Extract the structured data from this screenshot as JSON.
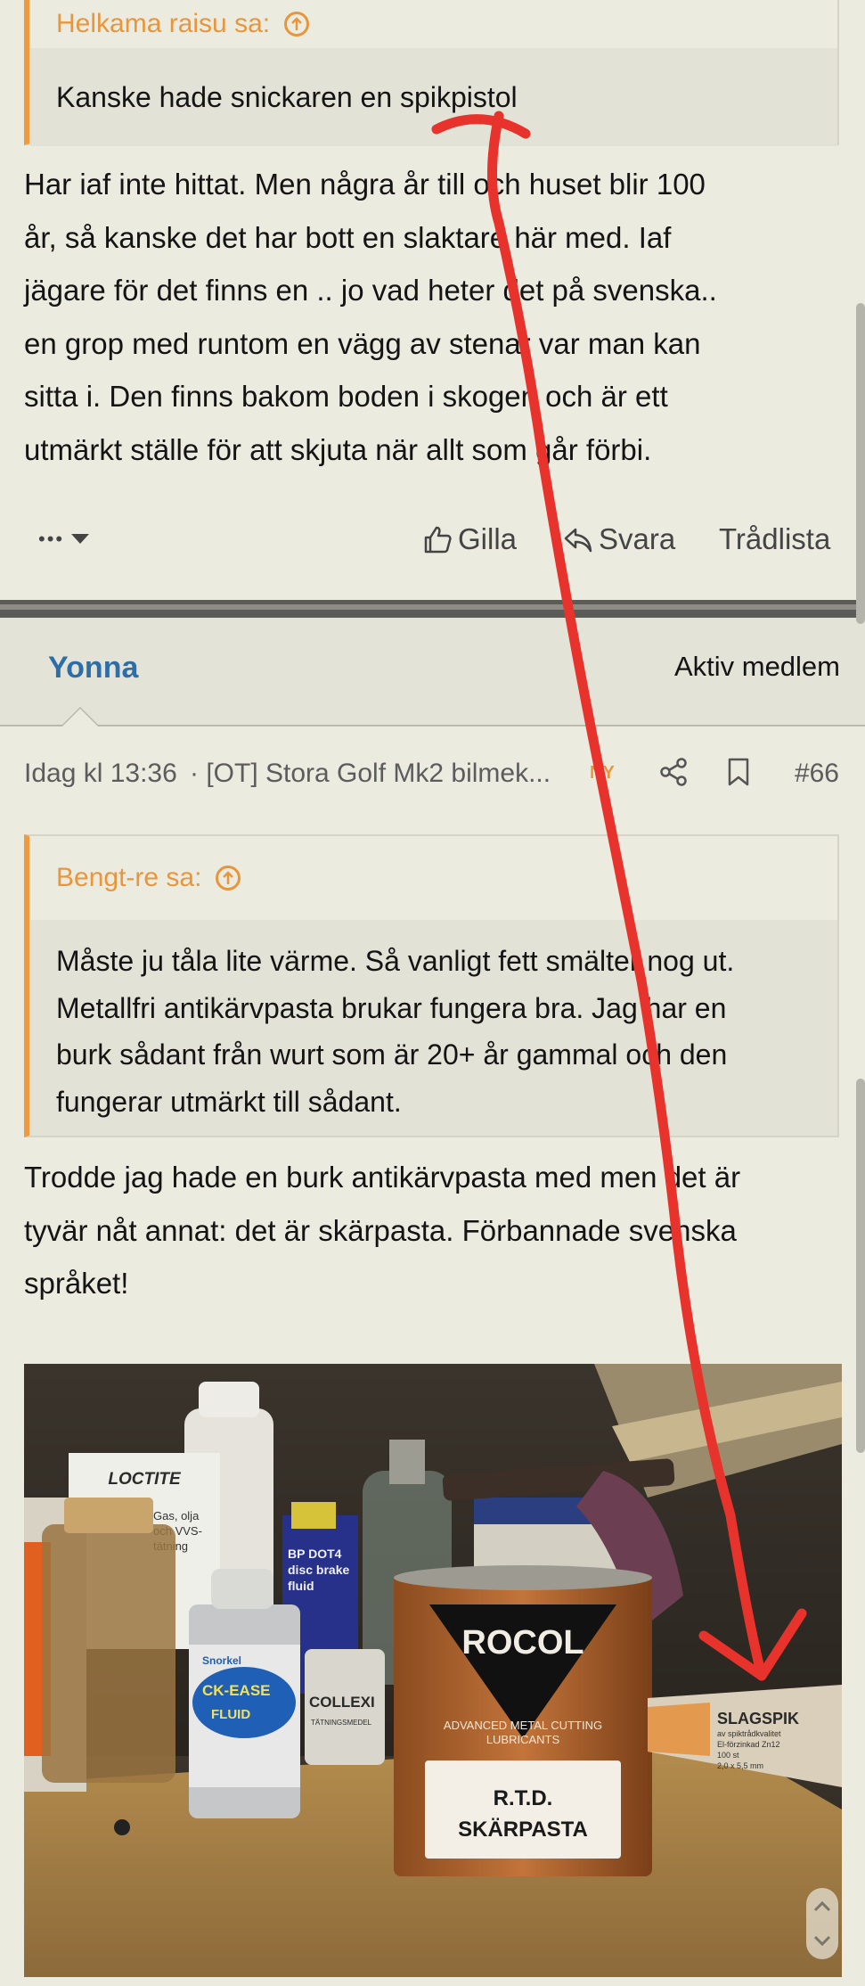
{
  "quote1": {
    "author": "Helkama raisu sa:",
    "text": "Kanske hade snickaren en spikpistol"
  },
  "post1": {
    "lines": [
      "Har iaf inte hittat. Men några år till och huset blir 100",
      "år, så kanske det har bott en slaktare här med. Iaf",
      "jägare för det finns en .. jo vad heter det på svenska..",
      "en grop med runtom en vägg av stenar var man kan",
      "sitta i. Den finns bakom boden i skogen och är ett",
      "utmärkt ställe för att skjuta när allt som går förbi."
    ],
    "more_label": "•••",
    "like_label": "Gilla",
    "reply_label": "Svara",
    "thread_label": "Trådlista"
  },
  "post2": {
    "username": "Yonna",
    "user_title": "Aktiv medlem",
    "timestamp": "Idag kl 13:36",
    "thread_title": "· [OT] Stora Golf Mk2 bilmek...",
    "new_badge": "NY",
    "post_number": "#66",
    "quote": {
      "author": "Bengt-re sa:",
      "lines": [
        "Måste ju tåla lite värme. Så vanligt fett smälter nog ut.",
        "Metallfri antikärvpasta brukar fungera bra. Jag har en",
        "burk sådant från wurt som är 20+ år gammal och den",
        "fungerar utmärkt till sådant."
      ]
    },
    "lines": [
      "Trodde jag hade en burk antikärvpasta med men det är",
      "tyvär nåt annat: det är skärpasta. Förbannade svenska",
      "språket!"
    ]
  },
  "photo": {
    "loctite_label": "LOCTITE",
    "loctite_text": [
      "Gas, olja",
      "och VVS-",
      "tätning"
    ],
    "bp_label": [
      "BP DOT4",
      "disc brake",
      "fluid"
    ],
    "snorkel_label": "Snorkel",
    "ease_label": "CK-EASE",
    "fluid_label": "FLUID",
    "colle_label": "COLLEXI",
    "colle_sub": "TÄTNINGSMEDEL",
    "rocol_brand": "ROCOL",
    "rocol_tagline": [
      "ADVANCED METAL CUTTING",
      "LUBRICANTS"
    ],
    "rocol_product": [
      "R.T.D.",
      "SKÄRPASTA"
    ],
    "slagspik_title": "SLAGSPIK",
    "slagspik_sub": [
      "av spiktrådkvalitet",
      "El-förzinkad Zn12",
      "100 st",
      "2,0 x 5,5 mm"
    ]
  },
  "colors": {
    "background": "#ecebe0",
    "quote_accent": "#ef9a3e",
    "username": "#2d6ea8",
    "annotation_red": "#e8332c"
  }
}
